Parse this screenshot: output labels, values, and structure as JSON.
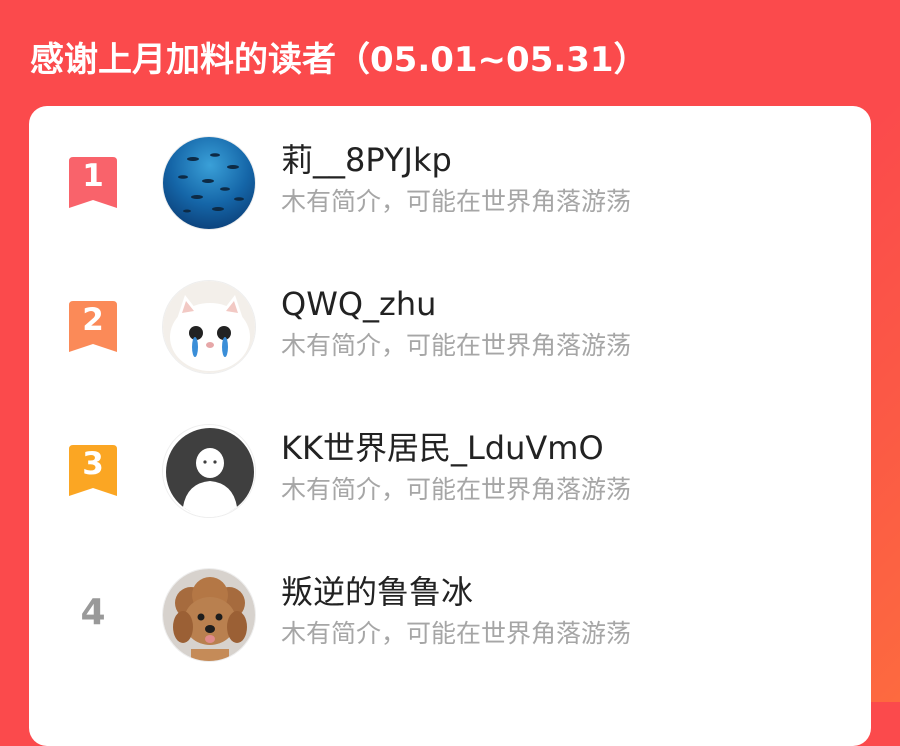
{
  "header": {
    "title": "感谢上月加料的读者（05.01~05.31）"
  },
  "colors": {
    "background": "#fb4a4c",
    "rank1": "#f9636b",
    "rank2": "#fb8a58",
    "rank3": "#fba623",
    "rank_plain": "#999999"
  },
  "readers": [
    {
      "rank": "1",
      "name": "莉__8PYJkp",
      "intro": "木有简介，可能在世界角落游荡",
      "avatar": "ocean-fish-avatar"
    },
    {
      "rank": "2",
      "name": "QWQ_zhu",
      "intro": "木有简介，可能在世界角落游荡",
      "avatar": "crying-cat-avatar"
    },
    {
      "rank": "3",
      "name": "KK世界居民_LduVmO",
      "intro": "木有简介，可能在世界角落游荡",
      "avatar": "default-person-avatar"
    },
    {
      "rank": "4",
      "name": "叛逆的鲁鲁冰",
      "intro": "木有简介，可能在世界角落游荡",
      "avatar": "poodle-dog-avatar"
    }
  ]
}
